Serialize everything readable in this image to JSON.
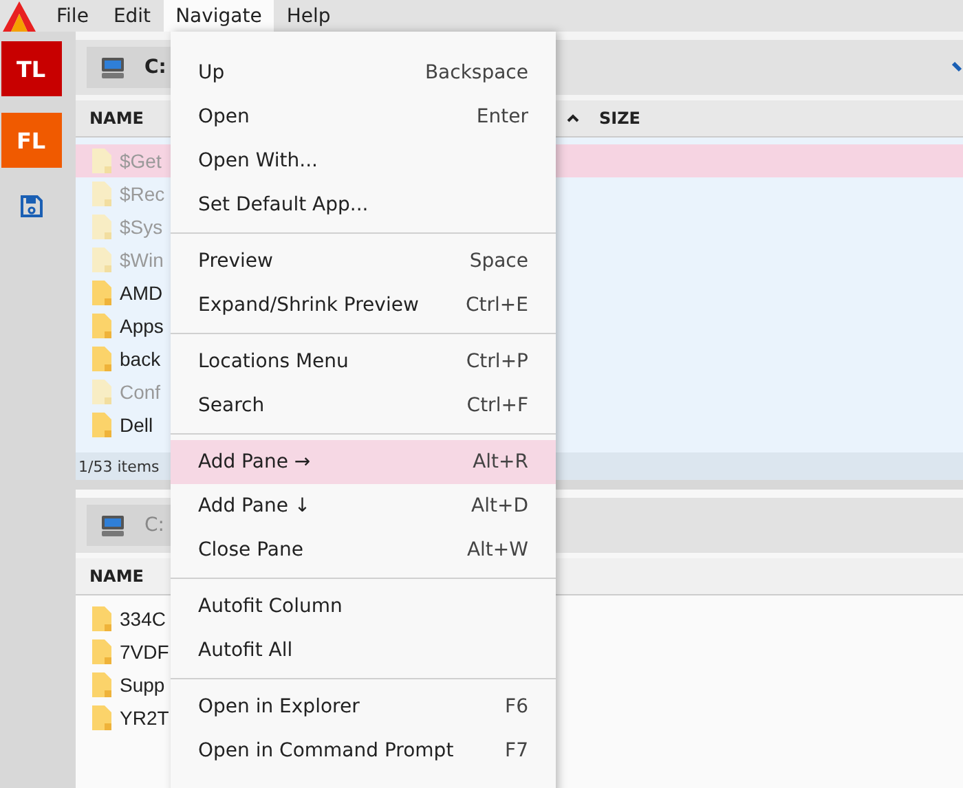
{
  "menubar": [
    {
      "label": "File",
      "selected": false
    },
    {
      "label": "Edit",
      "selected": false
    },
    {
      "label": "Navigate",
      "selected": true
    },
    {
      "label": "Help",
      "selected": false
    }
  ],
  "sidebar": [
    {
      "label": "TL",
      "color": "#c80000"
    },
    {
      "label": "FL",
      "color": "#f05a00"
    }
  ],
  "panes": [
    {
      "active": true,
      "path": "C:",
      "columns": [
        "NAME",
        "SIZE"
      ],
      "rows": [
        {
          "name": "$Get",
          "hidden": true,
          "selected": true
        },
        {
          "name": "$Rec",
          "hidden": true,
          "selected": false
        },
        {
          "name": "$Sys",
          "hidden": true,
          "selected": false
        },
        {
          "name": "$Win",
          "hidden": true,
          "selected": false
        },
        {
          "name": "AMD",
          "hidden": false,
          "selected": false
        },
        {
          "name": "Apps",
          "hidden": false,
          "selected": false
        },
        {
          "name": "back",
          "hidden": false,
          "selected": false
        },
        {
          "name": "Conf",
          "hidden": true,
          "selected": false
        },
        {
          "name": "Dell",
          "hidden": false,
          "selected": false
        }
      ],
      "status": "1/53 items"
    },
    {
      "active": false,
      "path": "C:",
      "columns": [
        "NAME"
      ],
      "rows": [
        {
          "name": "334C",
          "hidden": false,
          "selected": false
        },
        {
          "name": "7VDF",
          "hidden": false,
          "selected": false
        },
        {
          "name": "Supp",
          "hidden": false,
          "selected": false
        },
        {
          "name": "YR2T",
          "hidden": false,
          "selected": false
        }
      ]
    }
  ],
  "menu": {
    "sections": [
      [
        {
          "label": "Up",
          "shortcut": "Backspace",
          "highlighted": false
        },
        {
          "label": "Open",
          "shortcut": "Enter",
          "highlighted": false
        },
        {
          "label": "Open With...",
          "highlighted": false
        },
        {
          "label": "Set Default App...",
          "highlighted": false
        }
      ],
      [
        {
          "label": "Preview",
          "shortcut": "Space",
          "highlighted": false
        },
        {
          "label": "Expand/Shrink Preview",
          "shortcut": "Ctrl+E",
          "highlighted": false
        }
      ],
      [
        {
          "label": "Locations Menu",
          "shortcut": "Ctrl+P",
          "highlighted": false
        },
        {
          "label": "Search",
          "shortcut": "Ctrl+F",
          "highlighted": false
        }
      ],
      [
        {
          "label": "Add Pane →",
          "shortcut": "Alt+R",
          "highlighted": true
        },
        {
          "label": "Add Pane ↓",
          "shortcut": "Alt+D",
          "highlighted": false
        },
        {
          "label": "Close Pane",
          "shortcut": "Alt+W",
          "highlighted": false
        }
      ],
      [
        {
          "label": "Autofit Column",
          "highlighted": false
        },
        {
          "label": "Autofit All",
          "highlighted": false
        }
      ],
      [
        {
          "label": "Open in Explorer",
          "shortcut": "F6",
          "highlighted": false
        },
        {
          "label": "Open in Command Prompt",
          "shortcut": "F7",
          "highlighted": false
        }
      ]
    ]
  }
}
